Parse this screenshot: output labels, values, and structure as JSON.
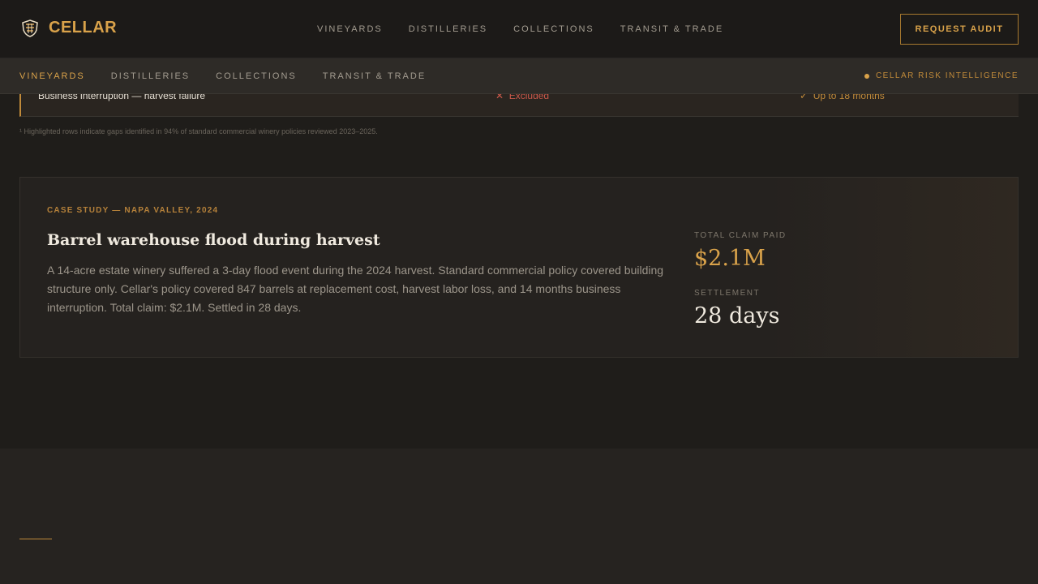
{
  "header": {
    "brand": "CELLAR",
    "logo_icon": "barrel-shield-icon",
    "nav": [
      "VINEYARDS",
      "DISTILLERIES",
      "COLLECTIONS",
      "TRANSIT & TRADE"
    ],
    "cta": "REQUEST AUDIT"
  },
  "subnav": {
    "items": [
      "VINEYARDS",
      "DISTILLERIES",
      "COLLECTIONS",
      "TRANSIT & TRADE"
    ],
    "active_index": 0,
    "badge": "CELLAR RISK INTELLIGENCE"
  },
  "coverage_row": {
    "item": "Business interruption — harvest failure",
    "standard_icon": "x-icon",
    "standard": "Excluded",
    "cellar_icon": "check-icon",
    "cellar": "Up to 18 months"
  },
  "footnote": "¹ Highlighted rows indicate gaps identified in 94% of standard commercial winery policies reviewed 2023–2025.",
  "case_study": {
    "tag": "CASE STUDY — NAPA VALLEY, 2024",
    "title": "Barrel warehouse flood during harvest",
    "body": "A 14-acre estate winery suffered a 3-day flood event during the 2024 harvest. Standard commercial policy covered building structure only. Cellar's policy covered 847 barrels at replacement cost, harvest labor loss, and 14 months business interruption. Total claim: $2.1M. Settled in 28 days.",
    "stats": [
      {
        "label": "TOTAL CLAIM PAID",
        "value": "$2.1M"
      },
      {
        "label": "SETTLEMENT",
        "value": "28 days"
      }
    ]
  },
  "colors": {
    "accent": "#d9a24a",
    "background": "#1f1d1a",
    "danger": "#c9584a"
  }
}
